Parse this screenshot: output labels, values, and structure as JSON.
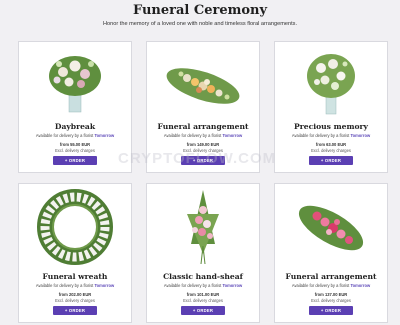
{
  "page": {
    "title": "Funeral Ceremony",
    "subtitle": "Honor the memory of a loved one with noble and timeless floral arrangements."
  },
  "watermark": "CRYPTOFLOW.COM",
  "products": [
    {
      "title": "Daybreak",
      "delivery_prefix": "Available for delivery by a florist",
      "delivery_day": "Tomorrow",
      "price": "from 55.00 EUR",
      "note": "Excl. delivery charges",
      "order": "+ ORDER"
    },
    {
      "title": "Funeral arrangement",
      "delivery_prefix": "Available for delivery by a florist",
      "delivery_day": "Tomorrow",
      "price": "from 149.00 EUR",
      "note": "Excl. delivery charges",
      "order": "+ ORDER"
    },
    {
      "title": "Precious memory",
      "delivery_prefix": "Available for delivery by a florist",
      "delivery_day": "Tomorrow",
      "price": "from 63.00 EUR",
      "note": "Excl. delivery charges",
      "order": "+ ORDER"
    },
    {
      "title": "Funeral wreath",
      "delivery_prefix": "Available for delivery by a florist",
      "delivery_day": "Tomorrow",
      "price": "from 202.00 EUR",
      "note": "Excl. delivery charges",
      "order": "+ ORDER"
    },
    {
      "title": "Classic hand-sheaf",
      "delivery_prefix": "Available for delivery by a florist",
      "delivery_day": "Tomorrow",
      "price": "from 101.00 EUR",
      "note": "Excl. delivery charges",
      "order": "+ ORDER"
    },
    {
      "title": "Funeral arrangement",
      "delivery_prefix": "Available for delivery by a florist",
      "delivery_day": "Tomorrow",
      "price": "from 137.00 EUR",
      "note": "Excl. delivery charges",
      "order": "+ ORDER"
    }
  ],
  "colors": {
    "accent": "#5b3fb3",
    "delivery_day": "#5b46b8",
    "background": "#f1f0f3"
  }
}
